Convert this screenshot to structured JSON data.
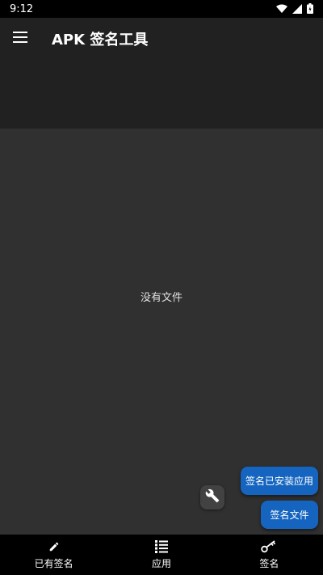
{
  "status_bar": {
    "time": "9:12"
  },
  "app_bar": {
    "title": "APK 签名工具"
  },
  "main": {
    "empty_text": "没有文件"
  },
  "fabs": {
    "installed_label": "签名已安装应用",
    "file_label": "签名文件"
  },
  "bottom_nav": {
    "items": [
      {
        "label": "已有签名",
        "icon": "pencil-icon"
      },
      {
        "label": "应用",
        "icon": "list-icon"
      },
      {
        "label": "签名",
        "icon": "key-icon"
      }
    ]
  },
  "colors": {
    "accent": "#1565c0",
    "app_bar": "#212121",
    "background": "#303030"
  }
}
